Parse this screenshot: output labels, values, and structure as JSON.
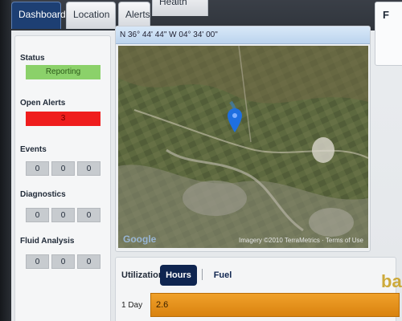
{
  "tabs": [
    {
      "label": "Dashboard",
      "active": true
    },
    {
      "label": "Location",
      "active": false
    },
    {
      "label": "Alerts",
      "active": false
    },
    {
      "label": "Health",
      "active": false
    }
  ],
  "right_panel": {
    "label": "F"
  },
  "sidebar": {
    "status": {
      "label": "Status",
      "value": "Reporting",
      "color": "#8bd16a"
    },
    "open_alerts": {
      "label": "Open Alerts",
      "value": "3",
      "color": "#ef1d1d"
    },
    "events": {
      "label": "Events",
      "values": [
        "0",
        "0",
        "0"
      ]
    },
    "diagnostics": {
      "label": "Diagnostics",
      "values": [
        "0",
        "0",
        "0"
      ]
    },
    "fluid_analysis": {
      "label": "Fluid Analysis",
      "values": [
        "0",
        "0",
        "0"
      ]
    }
  },
  "map": {
    "coordinates": "N 36° 44' 44\"  W 04° 34' 00\"",
    "provider_logo": "Google",
    "attribution": "Imagery ©2010 TerraMetrics · Terms of Use",
    "marker_icon": "map-pin-icon"
  },
  "utilization": {
    "label": "Utilization:",
    "hours_label": "Hours",
    "fuel_label": "Fuel",
    "rows": [
      {
        "label": "1 Day",
        "value": "2.6",
        "color": "#e8901a"
      }
    ]
  },
  "watermark": "ba"
}
